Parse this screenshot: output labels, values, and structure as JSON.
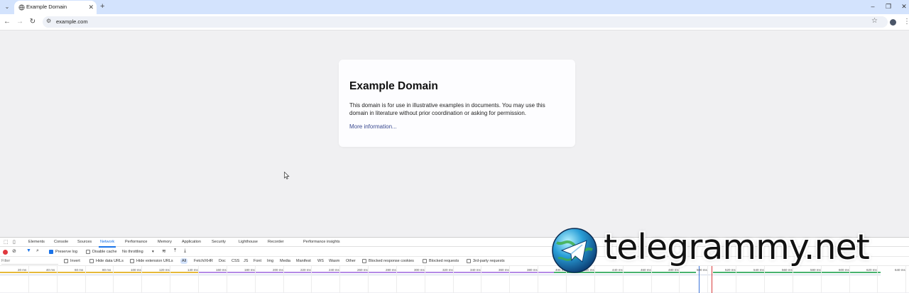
{
  "browser": {
    "tab_title": "Example Domain",
    "url": "example.com",
    "colors": {
      "tabstrip": "#d3e3fd",
      "link": "#38488f"
    }
  },
  "page": {
    "heading": "Example Domain",
    "body": "This domain is for use in illustrative examples in documents. You may use this domain in literature without prior coordination or asking for permission.",
    "link": "More information..."
  },
  "devtools": {
    "tabs": [
      "Elements",
      "Console",
      "Sources",
      "Network",
      "Performance",
      "Memory",
      "Application",
      "Security",
      "Lighthouse",
      "Recorder",
      "Performance insights"
    ],
    "active_tab": "Network",
    "toolbar": {
      "preserve_log": "Preserve log",
      "disable_cache": "Disable cache",
      "throttling": "No throttling"
    },
    "filter": {
      "placeholder": "Filter",
      "invert": "Invert",
      "hide_data_urls": "Hide data URLs",
      "hide_extension_urls": "Hide extension URLs",
      "types": [
        "All",
        "Fetch/XHR",
        "Doc",
        "CSS",
        "JS",
        "Font",
        "Img",
        "Media",
        "Manifest",
        "WS",
        "Wasm",
        "Other"
      ],
      "active_type": "All",
      "blocked_cookies": "Blocked response cookies",
      "blocked_requests": "Blocked requests",
      "third_party": "3rd-party requests"
    },
    "timeline_ticks": [
      "20 ms",
      "40 ms",
      "60 ms",
      "80 ms",
      "100 ms",
      "120 ms",
      "140 ms",
      "160 ms",
      "180 ms",
      "200 ms",
      "220 ms",
      "240 ms",
      "260 ms",
      "280 ms",
      "300 ms",
      "320 ms",
      "340 ms",
      "360 ms",
      "380 ms",
      "400 ms",
      "420 ms",
      "440 ms",
      "460 ms",
      "480 ms",
      "500 ms",
      "520 ms",
      "540 ms",
      "560 ms",
      "580 ms",
      "600 ms",
      "620 ms",
      "640 ms"
    ]
  },
  "watermark": {
    "text": "telegrammy.net"
  }
}
